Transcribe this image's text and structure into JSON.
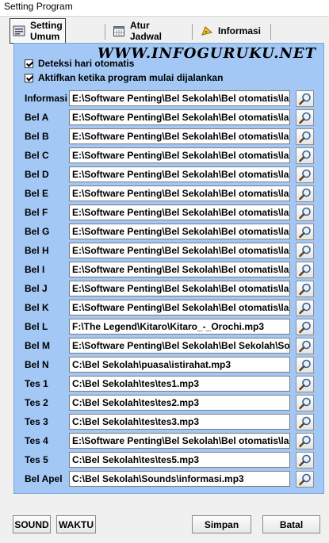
{
  "window": {
    "title": "Setting Program"
  },
  "tabs": [
    {
      "label": "Setting Umum",
      "icon": "settings-icon",
      "active": true
    },
    {
      "label": "Atur Jadwal",
      "icon": "calendar-icon",
      "active": false
    },
    {
      "label": "Informasi",
      "icon": "info-icon",
      "active": false
    }
  ],
  "watermark": "WWW.INFOGURUKU.NET",
  "options": [
    {
      "label": "Deteksi hari otomatis",
      "checked": true
    },
    {
      "label": "Aktifkan ketika program mulai dijalankan",
      "checked": true
    }
  ],
  "rows": [
    {
      "label": "Informasi",
      "path": "E:\\Software Penting\\Bel Sekolah\\Bel otomatis\\la"
    },
    {
      "label": "Bel A",
      "path": "E:\\Software Penting\\Bel Sekolah\\Bel otomatis\\la"
    },
    {
      "label": "Bel B",
      "path": "E:\\Software Penting\\Bel Sekolah\\Bel otomatis\\la"
    },
    {
      "label": "Bel C",
      "path": "E:\\Software Penting\\Bel Sekolah\\Bel otomatis\\la"
    },
    {
      "label": "Bel D",
      "path": "E:\\Software Penting\\Bel Sekolah\\Bel otomatis\\la"
    },
    {
      "label": "Bel E",
      "path": "E:\\Software Penting\\Bel Sekolah\\Bel otomatis\\la"
    },
    {
      "label": "Bel F",
      "path": "E:\\Software Penting\\Bel Sekolah\\Bel otomatis\\la"
    },
    {
      "label": "Bel G",
      "path": "E:\\Software Penting\\Bel Sekolah\\Bel otomatis\\la"
    },
    {
      "label": "Bel H",
      "path": "E:\\Software Penting\\Bel Sekolah\\Bel otomatis\\la"
    },
    {
      "label": "Bel I",
      "path": "E:\\Software Penting\\Bel Sekolah\\Bel otomatis\\la"
    },
    {
      "label": "Bel J",
      "path": "E:\\Software Penting\\Bel Sekolah\\Bel otomatis\\la"
    },
    {
      "label": "Bel K",
      "path": "E:\\Software Penting\\Bel Sekolah\\Bel otomatis\\la"
    },
    {
      "label": "Bel L",
      "path": "F:\\The Legend\\Kitaro\\Kitaro_-_Orochi.mp3"
    },
    {
      "label": "Bel M",
      "path": "E:\\Software Penting\\Bel Sekolah\\Bel Sekolah\\So"
    },
    {
      "label": "Bel N",
      "path": "C:\\Bel Sekolah\\puasa\\istirahat.mp3"
    },
    {
      "label": "Tes 1",
      "path": "C:\\Bel Sekolah\\tes\\tes1.mp3"
    },
    {
      "label": "Tes 2",
      "path": "C:\\Bel Sekolah\\tes\\tes2.mp3"
    },
    {
      "label": "Tes 3",
      "path": "C:\\Bel Sekolah\\tes\\tes3.mp3"
    },
    {
      "label": "Tes 4",
      "path": "E:\\Software Penting\\Bel Sekolah\\Bel otomatis\\la"
    },
    {
      "label": "Tes 5",
      "path": "C:\\Bel Sekolah\\tes\\tes5.mp3"
    },
    {
      "label": "Bel Apel",
      "path": "C:\\Bel Sekolah\\Sounds\\informasi.mp3"
    }
  ],
  "buttons": {
    "sound": "SOUND",
    "waktu": "WAKTU",
    "simpan": "Simpan",
    "batal": "Batal"
  },
  "colors": {
    "panel_bg": "#a3c8f5",
    "window_bg": "#f0f0f0"
  }
}
